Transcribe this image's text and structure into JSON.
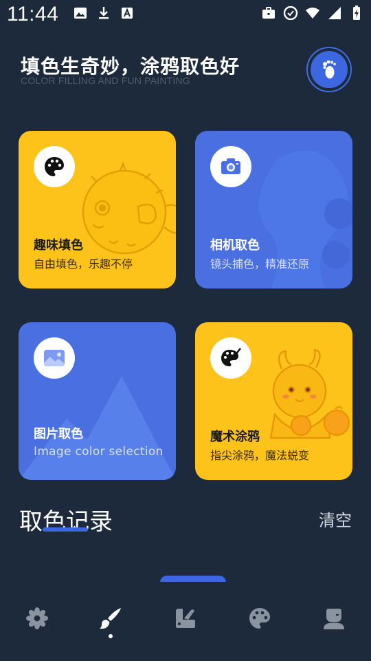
{
  "status_bar": {
    "time": "11:44",
    "left_icons": [
      "image-icon",
      "download-icon",
      "a-icon"
    ],
    "right_icons": [
      "briefcase-icon",
      "cast-icon",
      "wifi-icon",
      "signal-icon",
      "battery-icon"
    ]
  },
  "header": {
    "title": "填色生奇妙，涂鸦取色好",
    "subtitle": "COLOR FILLING AND FUN PAINTING",
    "avatar_icon": "footprint-icon"
  },
  "cards": [
    {
      "title": "趣味填色",
      "subtitle": "自由填色，乐趣不停",
      "icon": "palette-icon",
      "color": "#fdc31b"
    },
    {
      "title": "相机取色",
      "subtitle": "镜头捕色，精准还原",
      "icon": "camera-icon",
      "color": "#4a6fe0"
    },
    {
      "title": "图片取色",
      "subtitle": "Image color selection",
      "icon": "picture-icon",
      "color": "#4a6fe0"
    },
    {
      "title": "魔术涂鸦",
      "subtitle": "指尖涂鸦，魔法蜕变",
      "icon": "paint-palette-icon",
      "color": "#fdc31b"
    }
  ],
  "history": {
    "title": "取色记录",
    "clear_label": "清空"
  },
  "bottom_nav": {
    "items": [
      "flower-icon",
      "brush-icon",
      "color-swatch-icon",
      "palette-icon",
      "profile-icon"
    ],
    "active_index": 1
  },
  "colors": {
    "background": "#1d2a3c",
    "yellow": "#fdc31b",
    "blue": "#4a6fe0",
    "accent": "#3d67e0"
  }
}
